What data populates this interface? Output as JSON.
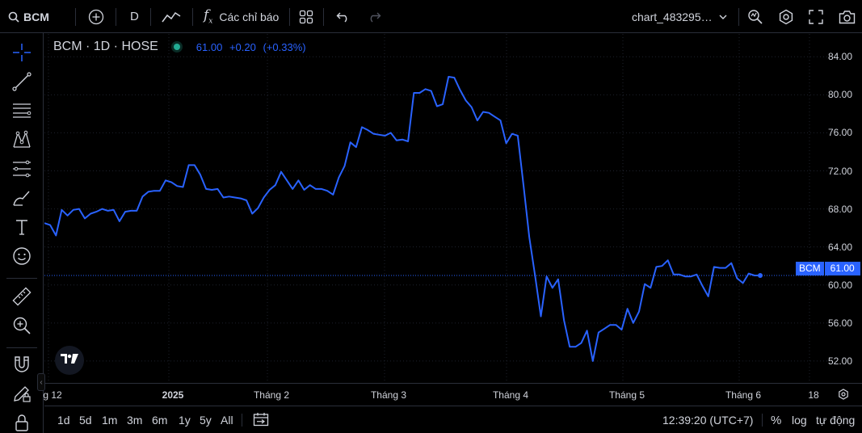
{
  "toolbar": {
    "symbol": "BCM",
    "interval": "D",
    "indicators_label": "Các chỉ báo",
    "layout_name": "chart_483295…"
  },
  "legend": {
    "title": "BCM · 1D · HOSE",
    "price": "61.00",
    "change": "+0.20",
    "change_pct": "(+0.33%)"
  },
  "price_axis": {
    "ticks": [
      "84.00",
      "80.00",
      "76.00",
      "72.00",
      "68.00",
      "64.00",
      "60.00",
      "56.00",
      "52.00"
    ],
    "last_symbol": "BCM",
    "last_price": "61.00"
  },
  "time_axis": {
    "ticks": [
      "g 12",
      "2025",
      "Tháng 2",
      "Tháng 3",
      "Tháng 4",
      "Tháng 5",
      "Tháng 6",
      "18"
    ]
  },
  "bottom": {
    "ranges": [
      "1d",
      "5d",
      "1m",
      "3m",
      "6m",
      "1y",
      "5y",
      "All"
    ],
    "clock": "12:39:20 (UTC+7)",
    "percent": "%",
    "log": "log",
    "auto": "tự động"
  },
  "colors": {
    "line": "#2962ff",
    "background": "#000000",
    "grid": "#1e222d",
    "live_dot": "#22ab94"
  },
  "chart_data": {
    "type": "line",
    "series": [
      {
        "name": "BCM",
        "values": [
          66.5,
          66.3,
          65.2,
          67.9,
          67.3,
          67.9,
          68.0,
          67.0,
          67.5,
          67.7,
          68.0,
          67.8,
          67.9,
          66.7,
          67.7,
          67.8,
          67.8,
          69.3,
          69.8,
          69.9,
          69.9,
          71.0,
          70.8,
          70.4,
          70.3,
          72.6,
          72.6,
          71.6,
          70.1,
          70.0,
          70.1,
          69.2,
          69.3,
          69.2,
          69.1,
          68.9,
          67.5,
          68.1,
          69.2,
          70.0,
          70.5,
          71.9,
          71.0,
          70.1,
          71.0,
          70.0,
          70.5,
          70.1,
          70.1,
          69.9,
          69.5,
          71.3,
          72.5,
          75.0,
          74.5,
          76.6,
          76.3,
          75.9,
          75.8,
          75.7,
          76.0,
          75.2,
          75.3,
          75.1,
          80.2,
          80.2,
          80.6,
          80.4,
          78.8,
          79.0,
          81.9,
          81.8,
          80.5,
          79.4,
          78.7,
          77.3,
          78.2,
          78.1,
          77.7,
          77.3,
          74.9,
          75.9,
          75.7,
          70.5,
          65.0,
          61.0,
          56.7,
          60.9,
          59.7,
          60.6,
          56.3,
          53.5,
          53.5,
          53.9,
          55.2,
          52.0,
          55.0,
          55.4,
          55.8,
          55.8,
          55.3,
          57.5,
          56.0,
          57.2,
          60.1,
          59.7,
          61.9,
          62.0,
          62.6,
          61.1,
          61.1,
          60.9,
          60.9,
          61.1,
          59.9,
          58.8,
          61.9,
          61.8,
          61.8,
          62.3,
          60.7,
          60.2,
          61.2,
          61.0,
          61.0
        ],
        "color": "#2962ff"
      }
    ],
    "x_labels": [
      "g 12",
      "2025",
      "Tháng 2",
      "Tháng 3",
      "Tháng 4",
      "Tháng 5",
      "Tháng 6",
      "18"
    ],
    "ylim": [
      49.7,
      86.4
    ],
    "y_ticks": [
      84,
      80,
      76,
      72,
      68,
      64,
      60,
      56,
      52
    ],
    "last_value": 61.0,
    "grid": true
  }
}
